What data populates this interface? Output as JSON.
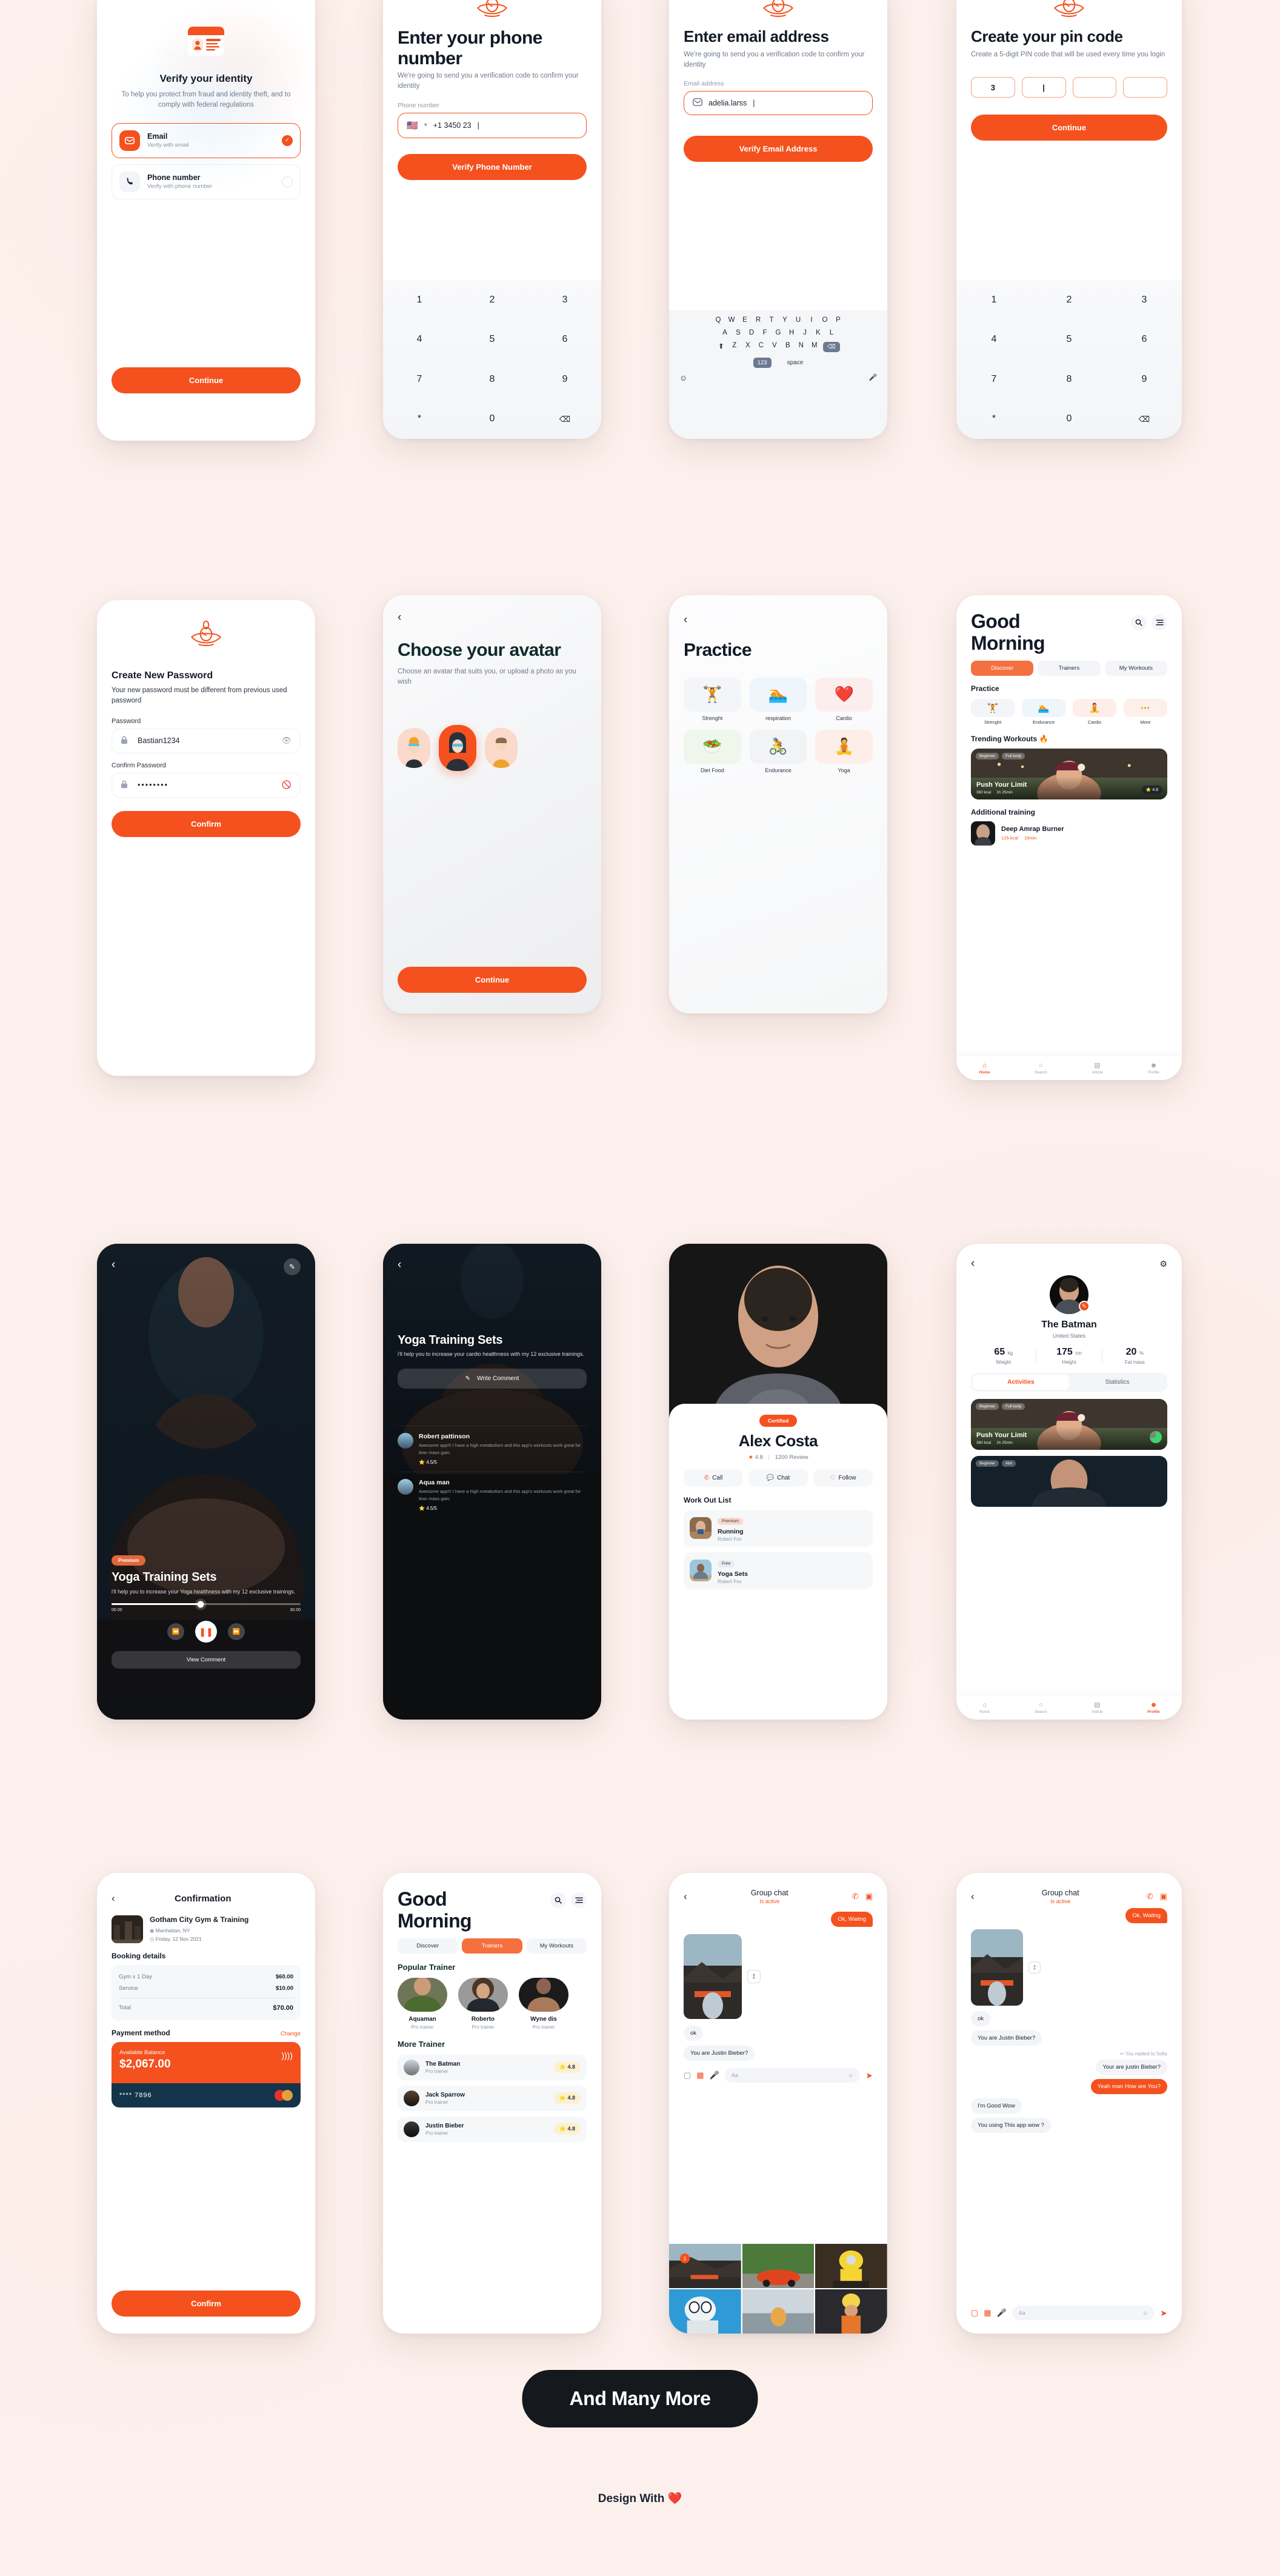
{
  "meta": {
    "footer_pill": "And Many More",
    "footer_note": "Design With ❤️",
    "accent": "#F4511E",
    "dark": "#121416",
    "bg": "#FCF0EC"
  },
  "s1_verify": {
    "title": "Verify your identity",
    "subtitle": "To help you protect from fraud and identity theft, and to comply with federal regulations",
    "options": [
      {
        "label": "Email",
        "sub": "Verify with email",
        "icon": "envelope-icon",
        "selected": true
      },
      {
        "label": "Phone number",
        "sub": "Verify with phone number",
        "icon": "phone-icon",
        "selected": false
      }
    ],
    "cta": "Continue"
  },
  "s2_phone": {
    "title": "Enter your phone number",
    "subtitle": "We're going to send you a verification code to confirm your identity",
    "field_label": "Phone number",
    "value": "+1 3450 23",
    "country_flag": "🇺🇸",
    "cta": "Verify Phone Number",
    "keypad": [
      "1",
      "2",
      "3",
      "4",
      "5",
      "6",
      "7",
      "8",
      "9",
      "*",
      "0",
      "⌫"
    ]
  },
  "s3_email": {
    "title": "Enter email address",
    "subtitle": "We're going to send you a verification code to confirm your identity",
    "field_label": "Email address",
    "value": "adelia.larss",
    "cta": "Verify Email Address",
    "keyboard": {
      "row1": [
        "Q",
        "W",
        "E",
        "R",
        "T",
        "Y",
        "U",
        "I",
        "O",
        "P"
      ],
      "row2": [
        "A",
        "S",
        "D",
        "F",
        "G",
        "H",
        "J",
        "K",
        "L"
      ],
      "row3": [
        "Z",
        "X",
        "C",
        "V",
        "B",
        "N",
        "M"
      ],
      "shift": "⬆",
      "backspace": "⌫",
      "num_key": "123",
      "space": "space",
      "emoji": "☺",
      "mic": "🎤"
    }
  },
  "s4_pin": {
    "title": "Create your pin code",
    "subtitle": "Create a 5-digit PIN code that will be used every time you login",
    "pins": [
      "3",
      "|",
      "",
      ""
    ],
    "cta": "Continue",
    "keypad": [
      "1",
      "2",
      "3",
      "4",
      "5",
      "6",
      "7",
      "8",
      "9",
      "*",
      "0",
      "⌫"
    ]
  },
  "s5_password": {
    "title": "Create New Password",
    "subtitle": "Your new password must be different from previous used password",
    "password_label": "Password",
    "password_value": "Bastian1234",
    "confirm_label": "Confirm Password",
    "confirm_value": "••••••••",
    "cta": "Confirm"
  },
  "s6_avatar": {
    "title": "Choose your avatar",
    "subtitle": "Choose an avatar that suits you, or upload a photo as you wish",
    "avatars": [
      "avatar-boy-cap",
      "avatar-girl-hoodie",
      "avatar-man-orange"
    ],
    "selected_index": 1,
    "cta": "Continue",
    "back": "‹"
  },
  "s7_practice": {
    "title": "Practice",
    "back": "‹",
    "items": [
      {
        "label": "Strenght",
        "emoji": "🏋️",
        "bg": "#f3f5f8"
      },
      {
        "label": "respiration",
        "emoji": "🏊",
        "bg": "#eef5fb"
      },
      {
        "label": "Cardio",
        "emoji": "❤️",
        "bg": "#fdeeee"
      },
      {
        "label": "Diet Food",
        "emoji": "🥗",
        "bg": "#eff6ec"
      },
      {
        "label": "Endurance",
        "emoji": "🚴",
        "bg": "#f2f3f4"
      },
      {
        "label": "Yoga",
        "emoji": "🧘",
        "bg": "#fdeee9"
      }
    ]
  },
  "s8_home": {
    "greeting_line1": "Good",
    "greeting_line2": "Morning",
    "search_icon": "search-icon",
    "menu_icon": "menu-icon",
    "tabs": [
      {
        "label": "Discover",
        "active": true
      },
      {
        "label": "Trainers",
        "active": false
      },
      {
        "label": "My Workouts",
        "active": false
      }
    ],
    "practice_heading": "Practice",
    "practice": [
      {
        "label": "Strenght",
        "emoji": "🏋️",
        "bg": "#f3f5f8"
      },
      {
        "label": "Endurance",
        "emoji": "🏊",
        "bg": "#eef5fb"
      },
      {
        "label": "Cardio",
        "emoji": "🧘",
        "bg": "#fdeeea"
      },
      {
        "label": "More",
        "emoji": "•••",
        "bg": "#fdf0ea"
      }
    ],
    "trending_heading": "Trending Workouts 🔥",
    "trending": {
      "tags": [
        "Beginner",
        "Full body"
      ],
      "title": "Push Your Limit",
      "kcal": "360 kcal",
      "time": "1h 25min",
      "rating": "⭐ 4.8"
    },
    "additional_heading": "Additional training",
    "additional": {
      "title": "Deep Amrap Burner",
      "kcal": "125 kcal",
      "time": "15min"
    },
    "nav": [
      {
        "label": "Home",
        "icon": "home-icon",
        "active": true
      },
      {
        "label": "Search",
        "icon": "search-icon",
        "active": false
      },
      {
        "label": "Article",
        "icon": "article-icon",
        "active": false
      },
      {
        "label": "Profile",
        "icon": "profile-icon",
        "active": false
      }
    ]
  },
  "s9_video": {
    "back": "‹",
    "edit_icon": "pencil-icon",
    "badge": "Premium",
    "title": "Yoga Training Sets",
    "subtitle": "i'll help you to increase your Yoga healthness with my 12 exclusive trainings.",
    "time_start": "00.00",
    "time_end": "30.00",
    "progress_pct": 47,
    "controls": [
      "rewind-icon",
      "pause-icon",
      "forward-icon"
    ],
    "view_comment": "View Comment"
  },
  "s10_comments": {
    "back": "‹",
    "title": "Yoga Training Sets",
    "subtitle": "i'll help you to increase your cardio healthness with my 12 exclusive trainings.",
    "write_comment": "Write Comment",
    "comments": [
      {
        "name": "Robert pattinson",
        "text": "Awesome app!!! I have a high metabolism and this app's workouts work great for lean mass gain.",
        "rating": "4.5/5"
      },
      {
        "name": "Aqua man",
        "text": "Awesome app!!! I have a high metabolism and this app's workouts work great for lean mass gain.",
        "rating": "4.5/5"
      }
    ]
  },
  "s11_trainer": {
    "badge": "Certified",
    "name": "Alex Costa",
    "rating": "4.8",
    "reviews": "1200 Review",
    "actions": [
      {
        "label": "Call",
        "icon": "phone-icon"
      },
      {
        "label": "Chat",
        "icon": "chat-icon"
      },
      {
        "label": "Follow",
        "icon": "heart-icon"
      }
    ],
    "list_heading": "Work Out List",
    "workouts": [
      {
        "tag": "Premium",
        "title": "Running",
        "author": "Robert Fox"
      },
      {
        "tag": "Free",
        "title": "Yoga Sets",
        "author": "Robert Fox"
      }
    ]
  },
  "s12_profile": {
    "back": "‹",
    "settings_icon": "gear-icon",
    "edit_icon": "pencil-icon",
    "name": "The Batman",
    "country": "United States",
    "stats": [
      {
        "value": "65",
        "unit": "kg",
        "label": "Weight"
      },
      {
        "value": "175",
        "unit": "cm",
        "label": "Height"
      },
      {
        "value": "20",
        "unit": "%",
        "label": "Fat mass"
      }
    ],
    "tabs": [
      {
        "label": "Activities",
        "active": true
      },
      {
        "label": "Statistics",
        "active": false
      }
    ],
    "cards": [
      {
        "tags": [
          "Beginner",
          "Full body"
        ],
        "title": "Push Your Limit",
        "kcal": "360 kcal",
        "time": "1h 25min"
      },
      {
        "tags": [
          "Beginner",
          "Abs"
        ],
        "title": "",
        "kcal": "",
        "time": ""
      }
    ],
    "nav": [
      {
        "label": "Home",
        "icon": "home-icon",
        "active": false
      },
      {
        "label": "Search",
        "icon": "search-icon",
        "active": false
      },
      {
        "label": "Article",
        "icon": "article-icon",
        "active": false
      },
      {
        "label": "Profile",
        "icon": "profile-icon",
        "active": true
      }
    ]
  },
  "s13_confirm": {
    "back": "‹",
    "title": "Confirmation",
    "gym_name": "Gotham City Gym & Training",
    "location": "Manhattan, NY",
    "date": "Friday, 12 Nov 2021",
    "booking_heading": "Booking details",
    "lines": [
      {
        "label": "Gym x 1 Day",
        "value": "$60.00"
      },
      {
        "label": "Service",
        "value": "$10.00"
      }
    ],
    "total_label": "Total",
    "total_value": "$70.00",
    "payment_heading": "Payment method",
    "change_link": "Change",
    "balance_label": "Available Balance",
    "balance_value": "$2,067.00",
    "card_number": "**** 7896",
    "cta": "Confirm"
  },
  "s14_trainers": {
    "greeting_line1": "Good",
    "greeting_line2": "Morning",
    "tabs": [
      {
        "label": "Discover",
        "active": false
      },
      {
        "label": "Trainers",
        "active": true
      },
      {
        "label": "My Workouts",
        "active": false
      }
    ],
    "popular_heading": "Popular Trainer",
    "popular": [
      {
        "name": "Aquaman",
        "role": "Pro trainer"
      },
      {
        "name": "Roberto",
        "role": "Pro trainer"
      },
      {
        "name": "Wyne dis",
        "role": "Pro trainer"
      }
    ],
    "more_heading": "More Trainer",
    "more": [
      {
        "name": "The Batman",
        "role": "Pro trainer",
        "rating": "4.8"
      },
      {
        "name": "Jack Sparrow",
        "role": "Pro trainer",
        "rating": "4.8"
      },
      {
        "name": "Justin Bieber",
        "role": "Pro trainer",
        "rating": "4.8"
      }
    ]
  },
  "s15_chat": {
    "back": "‹",
    "title": "Group chat",
    "status": "Is active",
    "call_icon": "phone-icon",
    "video_icon": "video-icon",
    "messages": [
      {
        "side": "out",
        "text": "Ok, Waitng"
      },
      {
        "side": "in",
        "type": "image"
      },
      {
        "side": "in",
        "text": "ok"
      },
      {
        "side": "in",
        "text": "You are Justin Bieber?"
      }
    ],
    "input_placeholder": "Aa",
    "tools": [
      "camera-icon",
      "gallery-icon",
      "mic-icon"
    ],
    "send_icon": "send-icon",
    "gallery_badge": "1"
  },
  "s16_chat2": {
    "back": "‹",
    "title": "Group chat",
    "status": "Is active",
    "messages": [
      {
        "side": "out",
        "text": "Ok, Waitng"
      },
      {
        "side": "in",
        "type": "image"
      },
      {
        "side": "in",
        "text": "ok"
      },
      {
        "side": "in",
        "text": "You are Justin Bieber?"
      },
      {
        "side": "meta",
        "text": "↩ You replied to Sofia"
      },
      {
        "side": "in",
        "text": "Your are justin Bieber?"
      },
      {
        "side": "out",
        "text": "Yeah man How are You?"
      },
      {
        "side": "in",
        "text": "I'm Good Wow"
      },
      {
        "side": "in",
        "text": "You using This app wow ?"
      }
    ],
    "input_placeholder": "Aa"
  }
}
